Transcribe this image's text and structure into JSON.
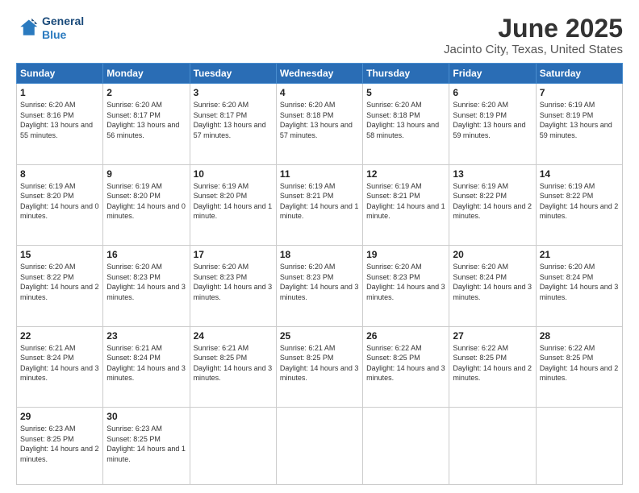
{
  "logo": {
    "line1": "General",
    "line2": "Blue"
  },
  "title": "June 2025",
  "subtitle": "Jacinto City, Texas, United States",
  "days_header": [
    "Sunday",
    "Monday",
    "Tuesday",
    "Wednesday",
    "Thursday",
    "Friday",
    "Saturday"
  ],
  "weeks": [
    [
      {
        "day": "1",
        "sunrise": "6:20 AM",
        "sunset": "8:16 PM",
        "daylight": "13 hours and 55 minutes."
      },
      {
        "day": "2",
        "sunrise": "6:20 AM",
        "sunset": "8:17 PM",
        "daylight": "13 hours and 56 minutes."
      },
      {
        "day": "3",
        "sunrise": "6:20 AM",
        "sunset": "8:17 PM",
        "daylight": "13 hours and 57 minutes."
      },
      {
        "day": "4",
        "sunrise": "6:20 AM",
        "sunset": "8:18 PM",
        "daylight": "13 hours and 57 minutes."
      },
      {
        "day": "5",
        "sunrise": "6:20 AM",
        "sunset": "8:18 PM",
        "daylight": "13 hours and 58 minutes."
      },
      {
        "day": "6",
        "sunrise": "6:20 AM",
        "sunset": "8:19 PM",
        "daylight": "13 hours and 59 minutes."
      },
      {
        "day": "7",
        "sunrise": "6:19 AM",
        "sunset": "8:19 PM",
        "daylight": "13 hours and 59 minutes."
      }
    ],
    [
      {
        "day": "8",
        "sunrise": "6:19 AM",
        "sunset": "8:20 PM",
        "daylight": "14 hours and 0 minutes."
      },
      {
        "day": "9",
        "sunrise": "6:19 AM",
        "sunset": "8:20 PM",
        "daylight": "14 hours and 0 minutes."
      },
      {
        "day": "10",
        "sunrise": "6:19 AM",
        "sunset": "8:20 PM",
        "daylight": "14 hours and 1 minute."
      },
      {
        "day": "11",
        "sunrise": "6:19 AM",
        "sunset": "8:21 PM",
        "daylight": "14 hours and 1 minute."
      },
      {
        "day": "12",
        "sunrise": "6:19 AM",
        "sunset": "8:21 PM",
        "daylight": "14 hours and 1 minute."
      },
      {
        "day": "13",
        "sunrise": "6:19 AM",
        "sunset": "8:22 PM",
        "daylight": "14 hours and 2 minutes."
      },
      {
        "day": "14",
        "sunrise": "6:19 AM",
        "sunset": "8:22 PM",
        "daylight": "14 hours and 2 minutes."
      }
    ],
    [
      {
        "day": "15",
        "sunrise": "6:20 AM",
        "sunset": "8:22 PM",
        "daylight": "14 hours and 2 minutes."
      },
      {
        "day": "16",
        "sunrise": "6:20 AM",
        "sunset": "8:23 PM",
        "daylight": "14 hours and 3 minutes."
      },
      {
        "day": "17",
        "sunrise": "6:20 AM",
        "sunset": "8:23 PM",
        "daylight": "14 hours and 3 minutes."
      },
      {
        "day": "18",
        "sunrise": "6:20 AM",
        "sunset": "8:23 PM",
        "daylight": "14 hours and 3 minutes."
      },
      {
        "day": "19",
        "sunrise": "6:20 AM",
        "sunset": "8:23 PM",
        "daylight": "14 hours and 3 minutes."
      },
      {
        "day": "20",
        "sunrise": "6:20 AM",
        "sunset": "8:24 PM",
        "daylight": "14 hours and 3 minutes."
      },
      {
        "day": "21",
        "sunrise": "6:20 AM",
        "sunset": "8:24 PM",
        "daylight": "14 hours and 3 minutes."
      }
    ],
    [
      {
        "day": "22",
        "sunrise": "6:21 AM",
        "sunset": "8:24 PM",
        "daylight": "14 hours and 3 minutes."
      },
      {
        "day": "23",
        "sunrise": "6:21 AM",
        "sunset": "8:24 PM",
        "daylight": "14 hours and 3 minutes."
      },
      {
        "day": "24",
        "sunrise": "6:21 AM",
        "sunset": "8:25 PM",
        "daylight": "14 hours and 3 minutes."
      },
      {
        "day": "25",
        "sunrise": "6:21 AM",
        "sunset": "8:25 PM",
        "daylight": "14 hours and 3 minutes."
      },
      {
        "day": "26",
        "sunrise": "6:22 AM",
        "sunset": "8:25 PM",
        "daylight": "14 hours and 3 minutes."
      },
      {
        "day": "27",
        "sunrise": "6:22 AM",
        "sunset": "8:25 PM",
        "daylight": "14 hours and 2 minutes."
      },
      {
        "day": "28",
        "sunrise": "6:22 AM",
        "sunset": "8:25 PM",
        "daylight": "14 hours and 2 minutes."
      }
    ],
    [
      {
        "day": "29",
        "sunrise": "6:23 AM",
        "sunset": "8:25 PM",
        "daylight": "14 hours and 2 minutes."
      },
      {
        "day": "30",
        "sunrise": "6:23 AM",
        "sunset": "8:25 PM",
        "daylight": "14 hours and 1 minute."
      },
      null,
      null,
      null,
      null,
      null
    ]
  ]
}
